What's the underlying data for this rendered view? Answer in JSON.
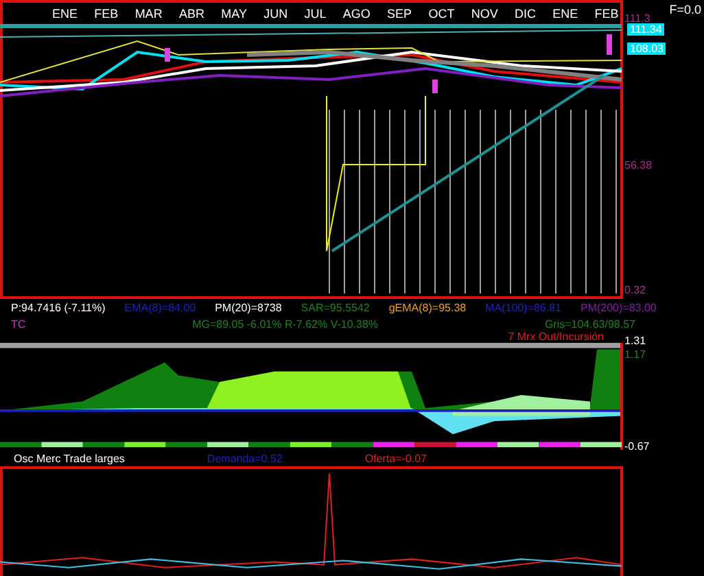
{
  "price_panel": {
    "months": [
      "ENE",
      "FEB",
      "MAR",
      "ABR",
      "MAY",
      "JUN",
      "JUL",
      "AGO",
      "SEP",
      "OCT",
      "NOV",
      "DIC",
      "ENE",
      "FEB"
    ],
    "factor": "F=0.0",
    "axis_labels": [
      {
        "text": "111.3",
        "kind": "plain",
        "color": "#a0308c"
      },
      {
        "text": "111.34",
        "kind": "boxed",
        "color": "#00e0f0"
      },
      {
        "text": "108.03",
        "kind": "boxed",
        "color": "#00e0f0"
      },
      {
        "text": "56.38",
        "kind": "plain",
        "color": "#a0308c"
      },
      {
        "text": "0.32",
        "kind": "plain",
        "color": "#a0308c"
      }
    ]
  },
  "indicators_row_1": [
    {
      "text": "P:94.7416 (-7.11%)",
      "color": "#ffffff"
    },
    {
      "text": "EMA(8)=84.00",
      "color": "#2020c0"
    },
    {
      "text": "PM(20)=8738",
      "color": "#ffffff"
    },
    {
      "text": "SAR=95.5542",
      "color": "#208020"
    },
    {
      "text": "gEMA(8)=95.38",
      "color": "#f0a020"
    },
    {
      "text": "MA(100)=86.81",
      "color": "#2020c0"
    },
    {
      "text": "PM(200)=83.00",
      "color": "#8020a0"
    }
  ],
  "indicators_row_2": [
    {
      "text": "TC",
      "color": "#d030d0"
    },
    {
      "text": "MG=89.05 -6.01% R-7.62% V-10.38%",
      "color": "#208020"
    },
    {
      "text": "Gris=104.63/98.57",
      "color": "#208020"
    }
  ],
  "oscillator_panel": {
    "title": "7 Mrx Out/Incursión",
    "axis_labels": [
      {
        "text": "1.31",
        "color": "#ffffff"
      },
      {
        "text": "1.17",
        "color": "#208020"
      },
      {
        "text": "-0.67",
        "color": "#ffffff"
      }
    ]
  },
  "trade_panel": {
    "labels": [
      {
        "text": "Osc Merc Trade larges",
        "color": "#ffffff"
      },
      {
        "text": "Demanda=0.52",
        "color": "#2020c0"
      },
      {
        "text": "Oferta=-0.07",
        "color": "#e02020"
      }
    ]
  }
}
